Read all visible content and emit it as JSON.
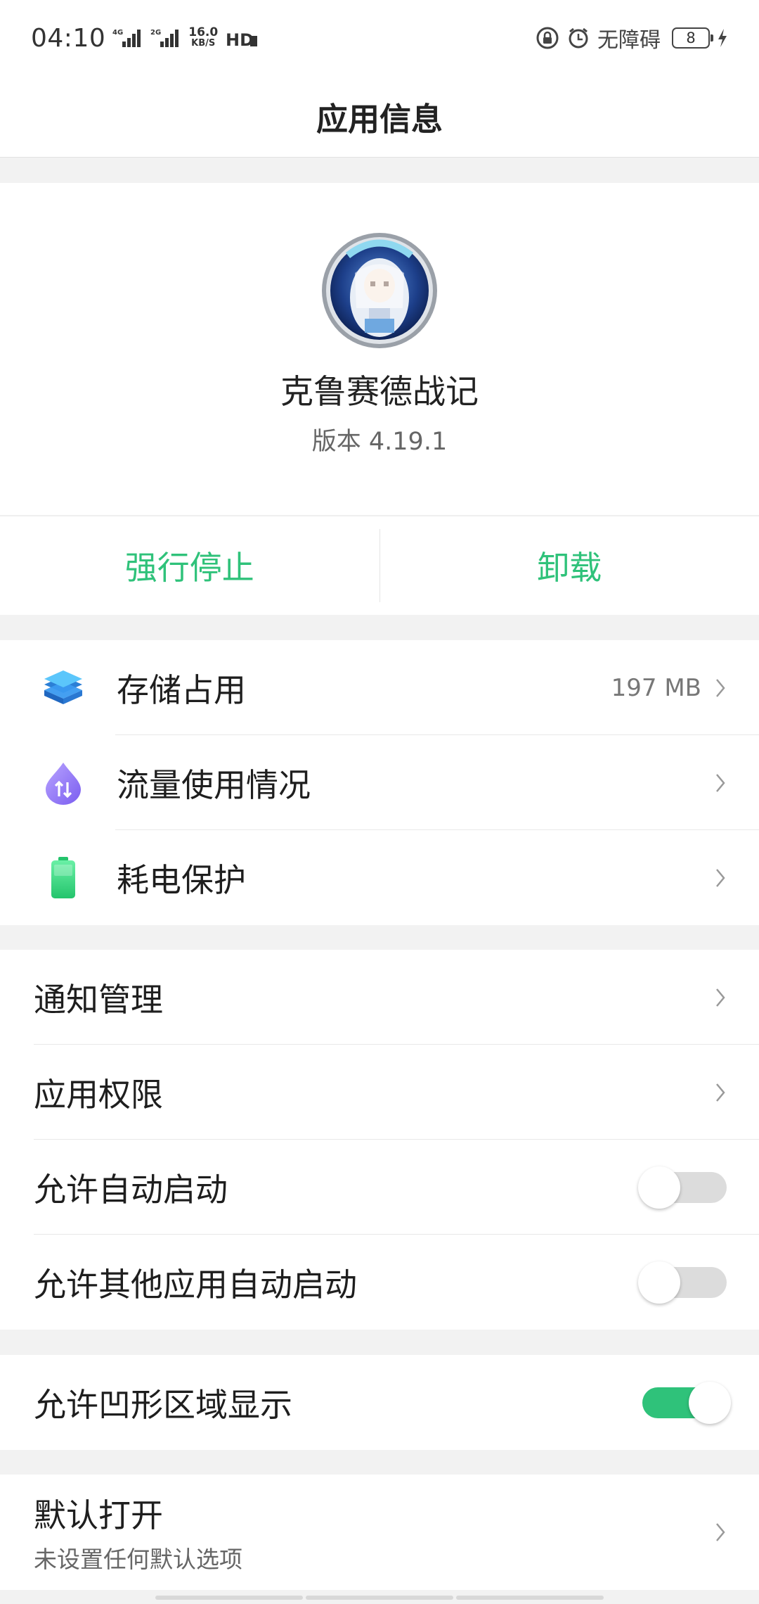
{
  "status_bar": {
    "time": "04:10",
    "net1": "4G",
    "net2": "2G",
    "speed_value": "16.0",
    "speed_unit": "KB/S",
    "hd": "HD",
    "accessibility": "无障碍",
    "battery": "8",
    "icons": [
      "signal-icon",
      "hd-icon",
      "lock-rotation-icon",
      "alarm-icon",
      "battery-icon",
      "charging-icon"
    ]
  },
  "header": {
    "title": "应用信息"
  },
  "app": {
    "name": "克鲁赛德战记",
    "version": "版本 4.19.1"
  },
  "actions": {
    "force_stop": "强行停止",
    "uninstall": "卸载"
  },
  "section1": {
    "items": [
      {
        "label": "存储占用",
        "value": "197 MB",
        "icon": "storage-icon"
      },
      {
        "label": "流量使用情况",
        "icon": "data-usage-icon"
      },
      {
        "label": "耗电保护",
        "icon": "battery-protect-icon"
      }
    ]
  },
  "section2": {
    "items": [
      {
        "label": "通知管理"
      },
      {
        "label": "应用权限"
      },
      {
        "label": "允许自动启动",
        "toggle": false
      },
      {
        "label": "允许其他应用自动启动",
        "toggle": false
      }
    ]
  },
  "section3": {
    "items": [
      {
        "label": "允许凹形区域显示",
        "toggle": true
      }
    ]
  },
  "section4": {
    "items": [
      {
        "label": "默认打开",
        "sublabel": "未设置任何默认选项"
      }
    ]
  },
  "colors": {
    "accent": "#2fc27a",
    "background": "#f2f2f2",
    "card": "#ffffff"
  }
}
